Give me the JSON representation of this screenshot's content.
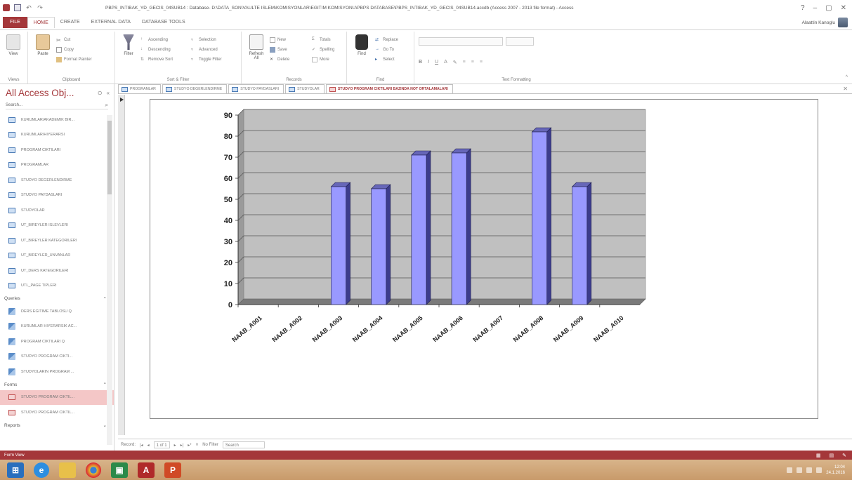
{
  "window": {
    "title": "PBPS_INTIBAK_YD_GECIS_04SUB14 : Database- D:\\DATA_SON\\VAULTE ISLEM\\KOMISYONLAR\\EGITIM KOMISYONU\\PBPS DATABASE\\PBPS_INTIBAK_YD_GECIS_04SUB14.accdb (Access 2007 - 2013 file format) - Access",
    "controls": [
      "?",
      "–",
      "▢",
      "✕"
    ]
  },
  "ribbon_tabs": [
    "FILE",
    "HOME",
    "CREATE",
    "EXTERNAL DATA",
    "DATABASE TOOLS"
  ],
  "active_tab": "HOME",
  "user_name": "Alaattin Kanoglu",
  "ribbon": {
    "views": {
      "view_label": "View",
      "group": "Views"
    },
    "clipboard": {
      "paste": "Paste",
      "cut": "Cut",
      "copy": "Copy",
      "format_painter": "Format Painter",
      "group": "Clipboard"
    },
    "sort_filter": {
      "filter": "Filter",
      "ascending": "Ascending",
      "descending": "Descending",
      "remove_sort": "Remove Sort",
      "selection": "Selection",
      "advanced": "Advanced",
      "toggle_filter": "Toggle Filter",
      "group": "Sort & Filter"
    },
    "records": {
      "refresh": "Refresh All",
      "new": "New",
      "save": "Save",
      "delete": "Delete",
      "totals": "Totals",
      "spelling": "Spelling",
      "more": "More",
      "group": "Records"
    },
    "find": {
      "find": "Find",
      "replace": "Replace",
      "goto": "Go To",
      "select": "Select",
      "group": "Find"
    },
    "text_formatting": {
      "bold": "B",
      "italic": "I",
      "underline": "U",
      "group": "Text Formatting"
    }
  },
  "nav": {
    "title": "All Access Obj...",
    "search_placeholder": "Search...",
    "tables": [
      "KURUMLAR/AKADEMIK BIR...",
      "KURUMLAR/HIYERARSI",
      "PROGRAM CIKTILARI",
      "PROGRAMLAR",
      "STUDYO DEGERLENDIRME",
      "STUDYO PAYDASLARI",
      "STUDYOLAR",
      "UT_BIREYLER ISLEVLERI",
      "UT_BIREYLER KATEGORILERI",
      "UT_BIREYLER_UNVANLAR",
      "UT_DERS KATEGORILERI",
      "UTL_PAGE TIPLERI"
    ],
    "queries_label": "Queries",
    "queries": [
      "DERS EGITIME TABLOSU Q",
      "KURUMLAR HIYERARSIK AC...",
      "PROGRAM CIKTILARI Q",
      "STUDYO PROGRAM CIKTI...",
      "STUDYOLARIN PROGRAM ..."
    ],
    "forms_label": "Forms",
    "forms": [
      "STUDYO PROGRAM CIKTIL...",
      "STUDYO PROGRAM CIKTIL..."
    ],
    "reports_label": "Reports"
  },
  "doc_tabs": [
    {
      "label": "PROGRAMLAR",
      "kind": "table"
    },
    {
      "label": "STUDYO DEGERLENDIRME",
      "kind": "table"
    },
    {
      "label": "STUDYO PAYDASLARI",
      "kind": "table"
    },
    {
      "label": "STUDYOLAR",
      "kind": "table"
    },
    {
      "label": "STUDYO PROGRAM CIKTILARI BAZINDA NOT ORTALAMALARI",
      "kind": "form"
    }
  ],
  "record_nav": {
    "label": "Record:",
    "position": "1 of 1",
    "filter": "No Filter",
    "search": "Search"
  },
  "status": {
    "left": "Form View"
  },
  "taskbar": {
    "time": "12:04",
    "date": "24.1.2016"
  },
  "chart_data": {
    "type": "bar",
    "categories": [
      "NAAB_A001",
      "NAAB_A002",
      "NAAB_A003",
      "NAAB_A004",
      "NAAB_A005",
      "NAAB_A006",
      "NAAB_A007",
      "NAAB_A008",
      "NAAB_A009",
      "NAAB_A010"
    ],
    "values": [
      0,
      0,
      56,
      55,
      71,
      72,
      0,
      82,
      56,
      0
    ],
    "ylim": [
      0,
      90
    ],
    "yticks": [
      0,
      10,
      20,
      30,
      40,
      50,
      60,
      70,
      80,
      90
    ],
    "grid": true,
    "bar_color": "#9999ff",
    "plot_bg": "#c0c0c0"
  }
}
